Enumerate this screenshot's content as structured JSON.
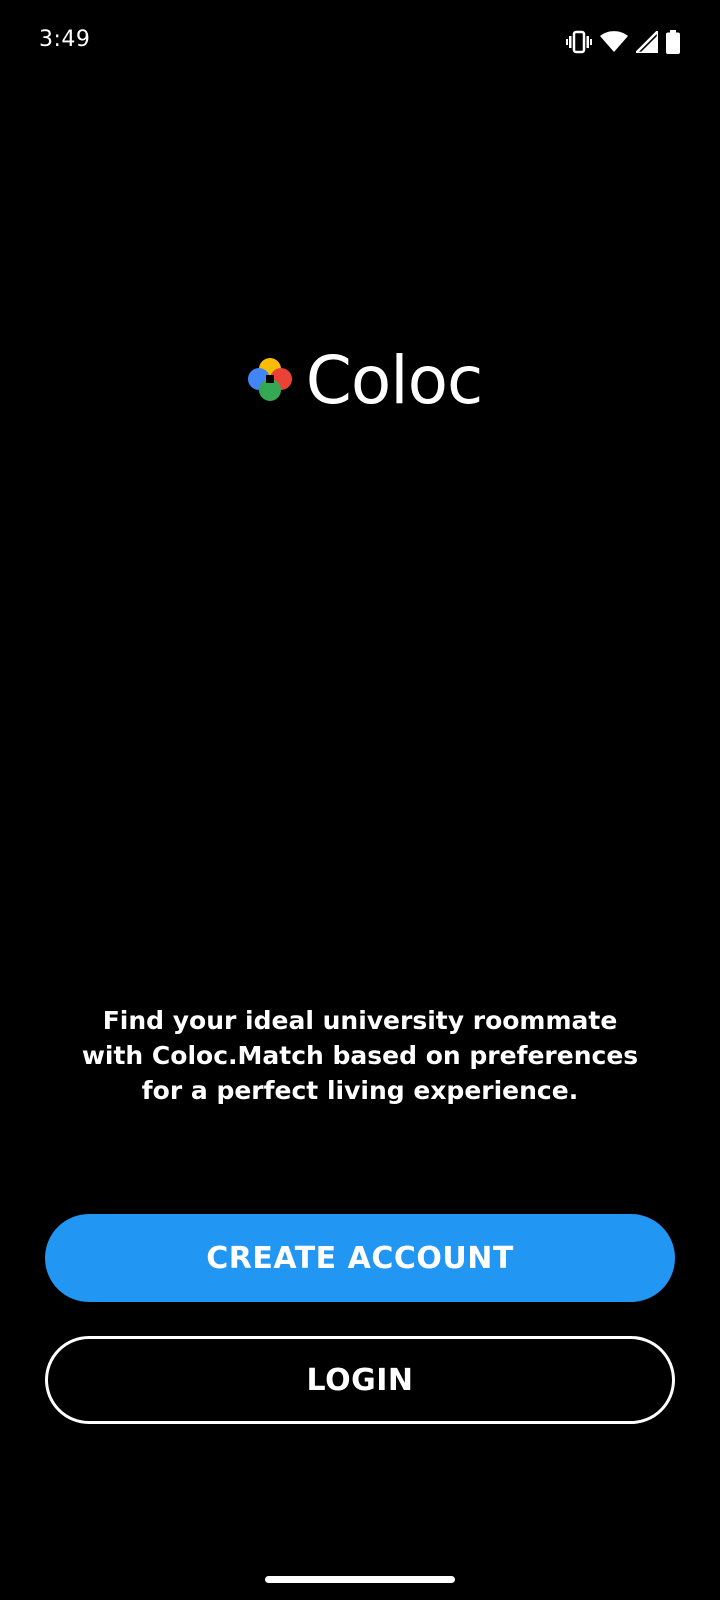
{
  "status_bar": {
    "time": "3:49",
    "icons": [
      "vibrate-icon",
      "wifi-icon",
      "signal-icon",
      "battery-icon"
    ]
  },
  "app": {
    "name": "Coloc",
    "logo_colors": [
      "#fbbc04",
      "#4285f4",
      "#ea4335",
      "#34a853"
    ]
  },
  "tagline": "Find your ideal university roommate with Coloc.Match based on preferences for a perfect living experience.",
  "buttons": {
    "create_account": "CREATE ACCOUNT",
    "login": "LOGIN"
  },
  "colors": {
    "background": "#000000",
    "primary": "#2196f3",
    "text": "#ffffff"
  }
}
